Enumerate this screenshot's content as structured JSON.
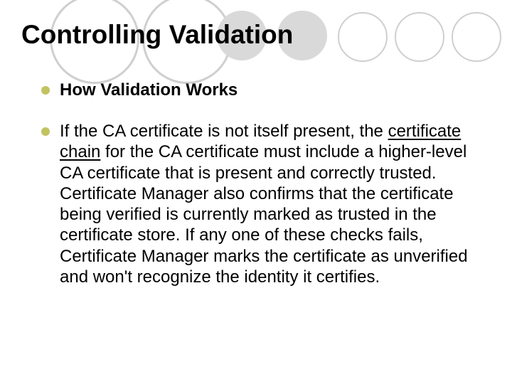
{
  "title": "Controlling Validation",
  "bullets": [
    {
      "text": "How Validation Works",
      "bold": true
    },
    {
      "pre": "If the CA certificate is not itself present, the ",
      "link": "certificate chain",
      "post": " for the CA certificate must include a higher-level CA certificate that is present and correctly trusted. Certificate Manager also confirms that the certificate being verified is currently marked as trusted in the certificate store. If any one of these checks fails, Certificate Manager marks the certificate as unverified and won't recognize the identity it certifies."
    }
  ]
}
